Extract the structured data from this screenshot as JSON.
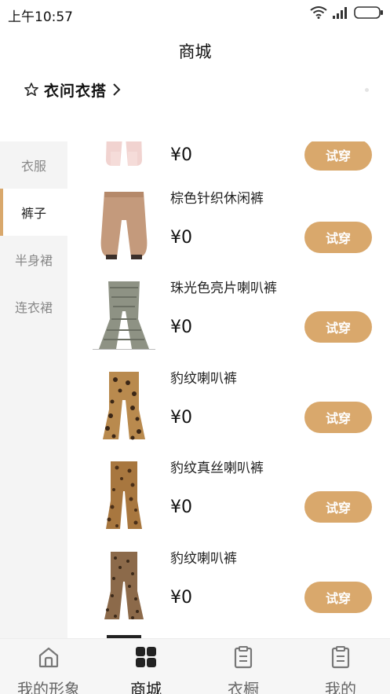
{
  "status_bar": {
    "time": "上午10:57"
  },
  "header": {
    "title": "商城"
  },
  "brand": {
    "label": "衣问衣搭",
    "icon": "star-icon",
    "chevron": "chevron-right-icon"
  },
  "sidebar": {
    "items": [
      {
        "label": "衣服",
        "active": false
      },
      {
        "label": "裤子",
        "active": true
      },
      {
        "label": "半身裙",
        "active": false
      },
      {
        "label": "连衣裙",
        "active": false
      }
    ]
  },
  "products": [
    {
      "name": "",
      "price": "¥0",
      "button": "试穿",
      "image": "pink-pants"
    },
    {
      "name": "棕色针织休闲裤",
      "price": "¥0",
      "button": "试穿",
      "image": "brown-knit-pants"
    },
    {
      "name": "珠光色亮片喇叭裤",
      "price": "¥0",
      "button": "试穿",
      "image": "sequin-flare-pants"
    },
    {
      "name": "豹纹喇叭裤",
      "price": "¥0",
      "button": "试穿",
      "image": "leopard-flare-pants"
    },
    {
      "name": "豹纹真丝喇叭裤",
      "price": "¥0",
      "button": "试穿",
      "image": "leopard-silk-flare-pants"
    },
    {
      "name": "豹纹喇叭裤",
      "price": "¥0",
      "button": "试穿",
      "image": "leopard-flare-pants-2"
    }
  ],
  "tabbar": {
    "tabs": [
      {
        "label": "我的形象",
        "icon": "home-icon",
        "active": false
      },
      {
        "label": "商城",
        "icon": "grid-icon",
        "active": true
      },
      {
        "label": "衣橱",
        "icon": "clipboard-icon",
        "active": false
      },
      {
        "label": "我的",
        "icon": "clipboard-icon",
        "active": false
      }
    ]
  },
  "colors": {
    "accent": "#d9a86c",
    "sidebar_bg": "#f4f4f4"
  }
}
